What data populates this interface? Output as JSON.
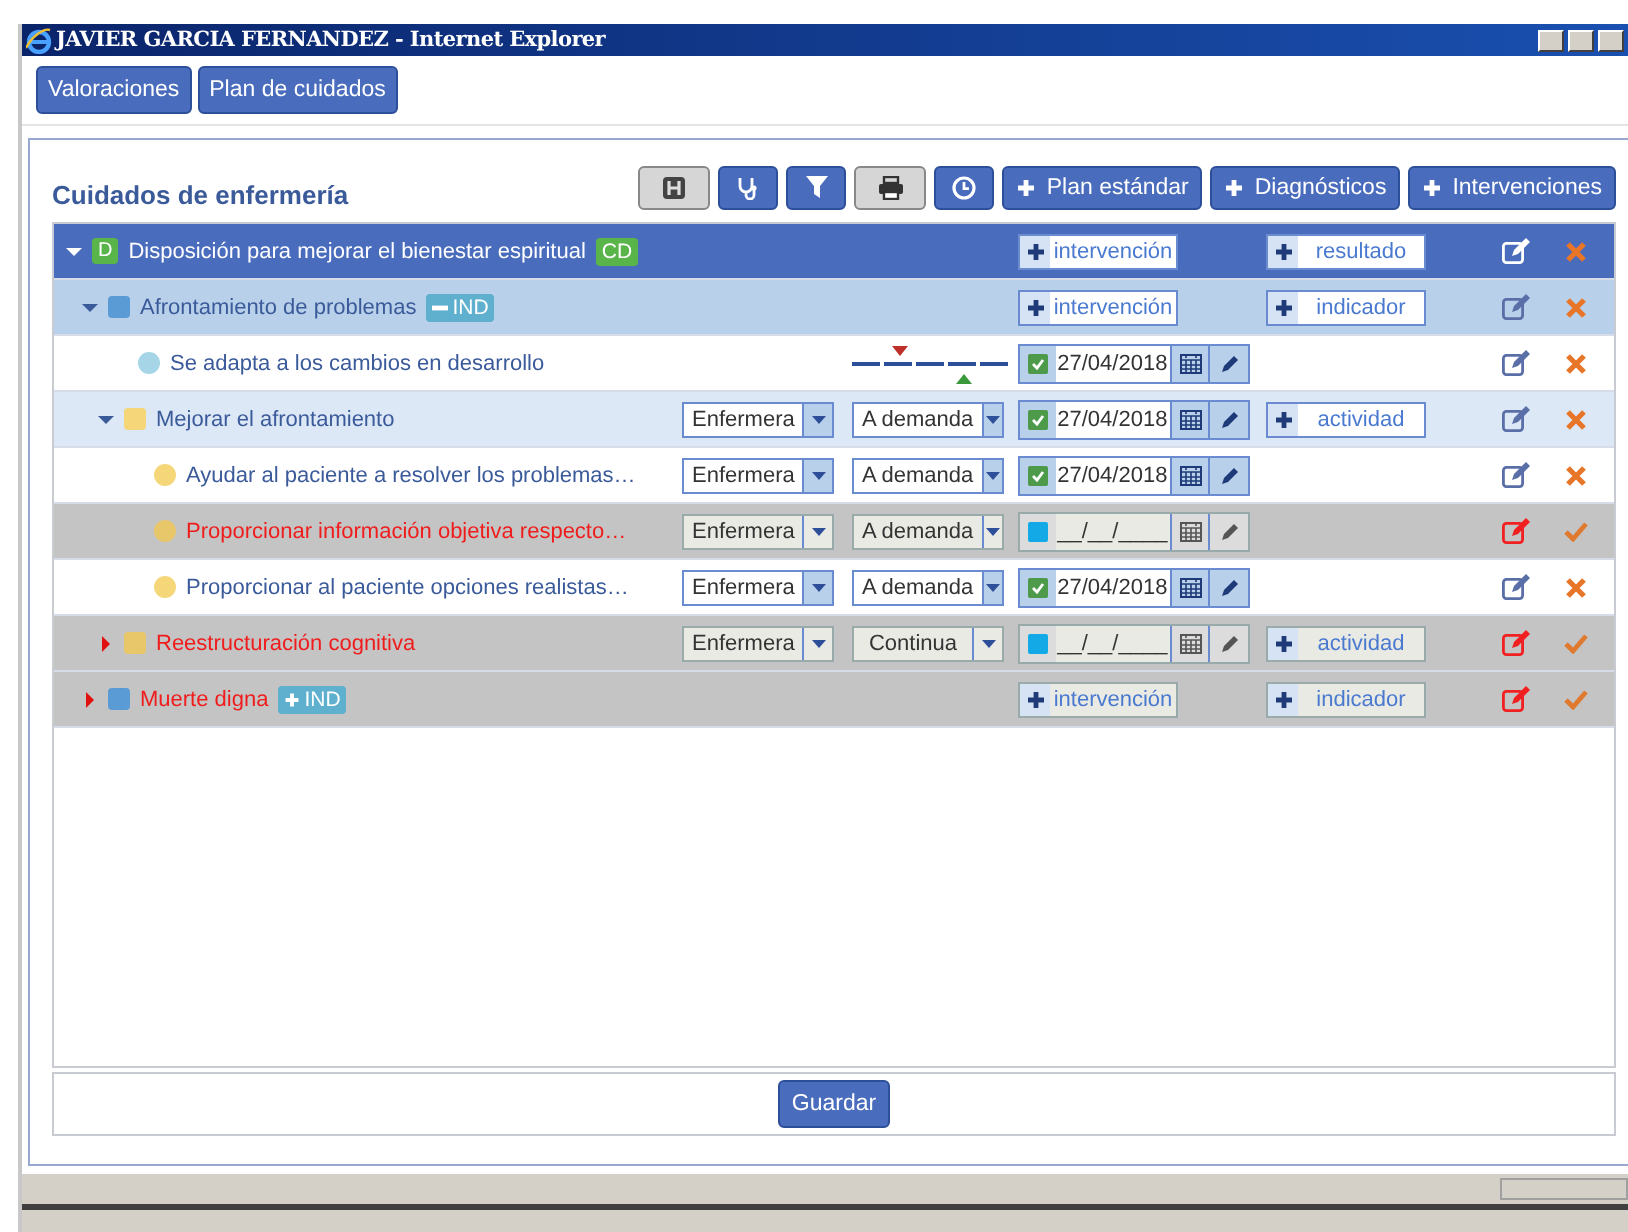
{
  "window": {
    "title": "JAVIER GARCIA FERNANDEZ - Internet Explorer"
  },
  "tabs": [
    {
      "label": "Valoraciones"
    },
    {
      "label": "Plan de cuidados"
    }
  ],
  "panel": {
    "title": "Cuidados de enfermería"
  },
  "toolbar": [
    {
      "kind": "icon",
      "pressed": true
    },
    {
      "kind": "icon",
      "pressed": false
    },
    {
      "kind": "icon",
      "pressed": false
    },
    {
      "kind": "icon",
      "pressed": true
    },
    {
      "kind": "icon",
      "pressed": false
    },
    {
      "kind": "add",
      "label": "Plan estándar"
    },
    {
      "kind": "add",
      "label": "Diagnósticos"
    },
    {
      "kind": "add",
      "label": "Intervenciones"
    }
  ],
  "tree": [
    {
      "kind": "diagnosis",
      "label": "Disposición para mejorar el bienestar espiritual",
      "marker": "D",
      "badge": {
        "label": "CD",
        "kind": "plain"
      },
      "expanded": true,
      "pending": false,
      "add_left": "intervención",
      "add_right": "resultado",
      "children": [
        {
          "kind": "outcome",
          "label": "Afrontamiento de problemas",
          "color": "#5b9bd5",
          "badge": {
            "label": "IND",
            "kind": "minus"
          },
          "expanded": true,
          "pending": false,
          "add_left": "intervención",
          "add_right": "indicador",
          "children": [
            {
              "kind": "indicator",
              "label": "Se adapta a los cambios en desarrollo",
              "color": "#a6d5e8",
              "pending": false,
              "date": "27/04/2018",
              "done": true
            },
            {
              "kind": "intervention",
              "label": "Mejorar el afrontamiento",
              "color": "#f5d77a",
              "expanded": true,
              "pending": false,
              "role": "Enfermera",
              "frequency": "A demanda",
              "date": "27/04/2018",
              "done": true,
              "add_right": "actividad",
              "children": [
                {
                  "kind": "activity",
                  "label": "Ayudar al paciente a resolver los problemas…",
                  "color": "#f5d77a",
                  "pending": false,
                  "role": "Enfermera",
                  "frequency": "A demanda",
                  "date": "27/04/2018",
                  "done": true
                },
                {
                  "kind": "activity",
                  "label": "Proporcionar información objetiva respecto…",
                  "color": "#e8c66a",
                  "pending": true,
                  "role": "Enfermera",
                  "frequency": "A demanda",
                  "date": "__/__/____",
                  "done": false
                },
                {
                  "kind": "activity",
                  "label": "Proporcionar al paciente opciones realistas…",
                  "color": "#f5d77a",
                  "pending": false,
                  "role": "Enfermera",
                  "frequency": "A demanda",
                  "date": "27/04/2018",
                  "done": true
                }
              ]
            },
            {
              "kind": "intervention",
              "label": "Reestructuración cognitiva",
              "color": "#e8c66a",
              "expanded": false,
              "pending": true,
              "role": "Enfermera",
              "frequency": "Continua",
              "date": "__/__/____",
              "done": false,
              "add_right": "actividad"
            }
          ]
        },
        {
          "kind": "outcome",
          "label": "Muerte digna",
          "color": "#5b9bd5",
          "badge": {
            "label": "IND",
            "kind": "plus"
          },
          "expanded": false,
          "pending": true,
          "add_left": "intervención",
          "add_right": "indicador"
        }
      ]
    }
  ],
  "footer": {
    "button": "Guardar"
  }
}
